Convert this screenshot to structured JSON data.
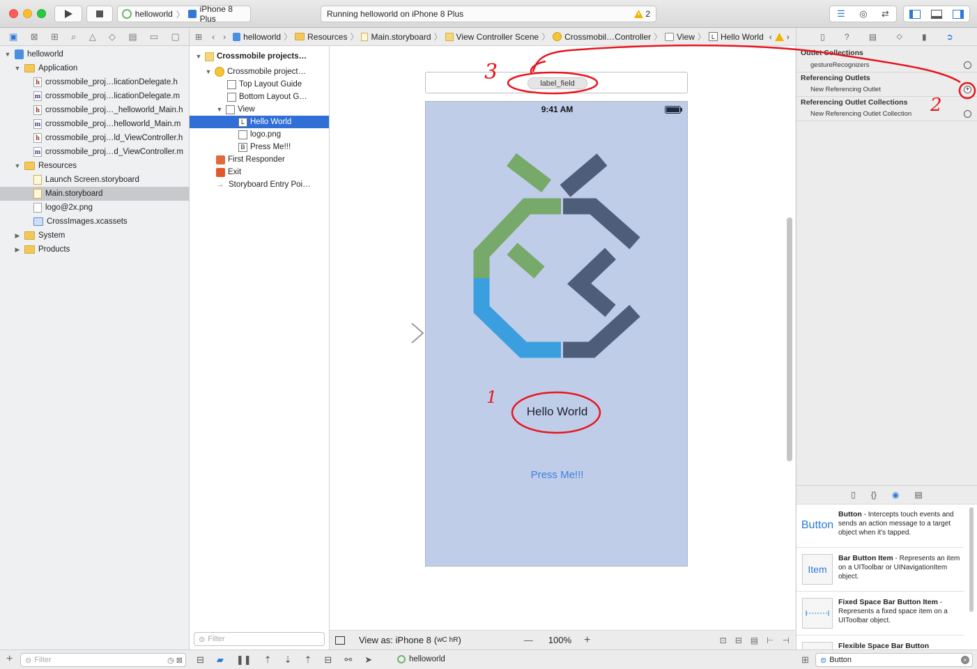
{
  "toolbar": {
    "scheme": "helloworld",
    "device": "iPhone 8 Plus",
    "status": "Running helloworld on iPhone 8 Plus",
    "warning_count": "2"
  },
  "jumpbar": {
    "crumbs": [
      "helloworld",
      "Resources",
      "Main.storyboard",
      "View Controller Scene",
      "Crossmobil…Controller",
      "View",
      "Hello World"
    ]
  },
  "navigator": {
    "rows": [
      {
        "label": "helloworld",
        "icon": "project-icon"
      },
      {
        "label": "Application",
        "icon": "folder-icon"
      },
      {
        "label": "crossmobile_proj…licationDelegate.h",
        "icon": "h-file-icon"
      },
      {
        "label": "crossmobile_proj…licationDelegate.m",
        "icon": "m-file-icon"
      },
      {
        "label": "crossmobile_proj…_helloworld_Main.h",
        "icon": "h-file-icon"
      },
      {
        "label": "crossmobile_proj…helloworld_Main.m",
        "icon": "m-file-icon"
      },
      {
        "label": "crossmobile_proj…ld_ViewController.h",
        "icon": "h-file-icon"
      },
      {
        "label": "crossmobile_proj…d_ViewController.m",
        "icon": "m-file-icon"
      },
      {
        "label": "Resources",
        "icon": "folder-icon"
      },
      {
        "label": "Launch Screen.storyboard",
        "icon": "storyboard-icon"
      },
      {
        "label": "Main.storyboard",
        "icon": "storyboard-icon"
      },
      {
        "label": "logo@2x.png",
        "icon": "image-icon"
      },
      {
        "label": "CrossImages.xcassets",
        "icon": "xcassets-icon"
      },
      {
        "label": "System",
        "icon": "folder-icon"
      },
      {
        "label": "Products",
        "icon": "folder-icon"
      }
    ],
    "filter_placeholder": "Filter"
  },
  "outline": {
    "rows": [
      {
        "label": "Crossmobile projects…",
        "glyph": ""
      },
      {
        "label": "Crossmobile project…",
        "glyph": ""
      },
      {
        "label": "Top Layout Guide",
        "glyph": ""
      },
      {
        "label": "Bottom Layout G…",
        "glyph": ""
      },
      {
        "label": "View",
        "glyph": ""
      },
      {
        "label": "Hello World",
        "glyph": "L"
      },
      {
        "label": "logo.png",
        "glyph": ""
      },
      {
        "label": "Press Me!!!",
        "glyph": "B"
      },
      {
        "label": "First Responder",
        "glyph": ""
      },
      {
        "label": "Exit",
        "glyph": ""
      },
      {
        "label": "Storyboard Entry Poi…",
        "glyph": ""
      }
    ],
    "filter_placeholder": "Filter"
  },
  "canvas": {
    "outlet_chip": "label_field",
    "phone_time": "9:41 AM",
    "label_text": "Hello World",
    "button_text": "Press Me!!!",
    "annotations": [
      "1",
      "2",
      "3"
    ],
    "colors": {
      "phone_bg": "#bfcde8",
      "green": "#76a96a",
      "navy": "#4e5d7a",
      "blue": "#3b9fdf",
      "button": "#3f7fe0"
    }
  },
  "canvas_footer": {
    "view_as": "View as: iPhone 8",
    "size_class_w": "wC",
    "size_class_h": "hR",
    "zoom": "100%",
    "minus": "—",
    "plus": "+"
  },
  "inspector": {
    "sections": [
      {
        "title": "Outlet Collections",
        "items": [
          "gestureRecognizers"
        ]
      },
      {
        "title": "Referencing Outlets",
        "items": [
          "New Referencing Outlet"
        ]
      },
      {
        "title": "Referencing Outlet Collections",
        "items": [
          "New Referencing Outlet Collection"
        ]
      }
    ]
  },
  "library": {
    "items": [
      {
        "thumb": "Button",
        "name": "Button",
        "desc": " - Intercepts touch events and sends an action message to a target object when it's tapped."
      },
      {
        "thumb": "Item",
        "name": "Bar Button Item",
        "desc": " - Represents an item on a UIToolbar or UINavigationItem object."
      },
      {
        "thumb": "",
        "name": "Fixed Space Bar Button Item",
        "desc": " - Represents a fixed space item on a UIToolbar object."
      },
      {
        "thumb": "",
        "name": "Flexible Space Bar Button",
        "desc": ""
      }
    ],
    "search_value": "Button"
  },
  "debugbar": {
    "target": "helloworld"
  }
}
